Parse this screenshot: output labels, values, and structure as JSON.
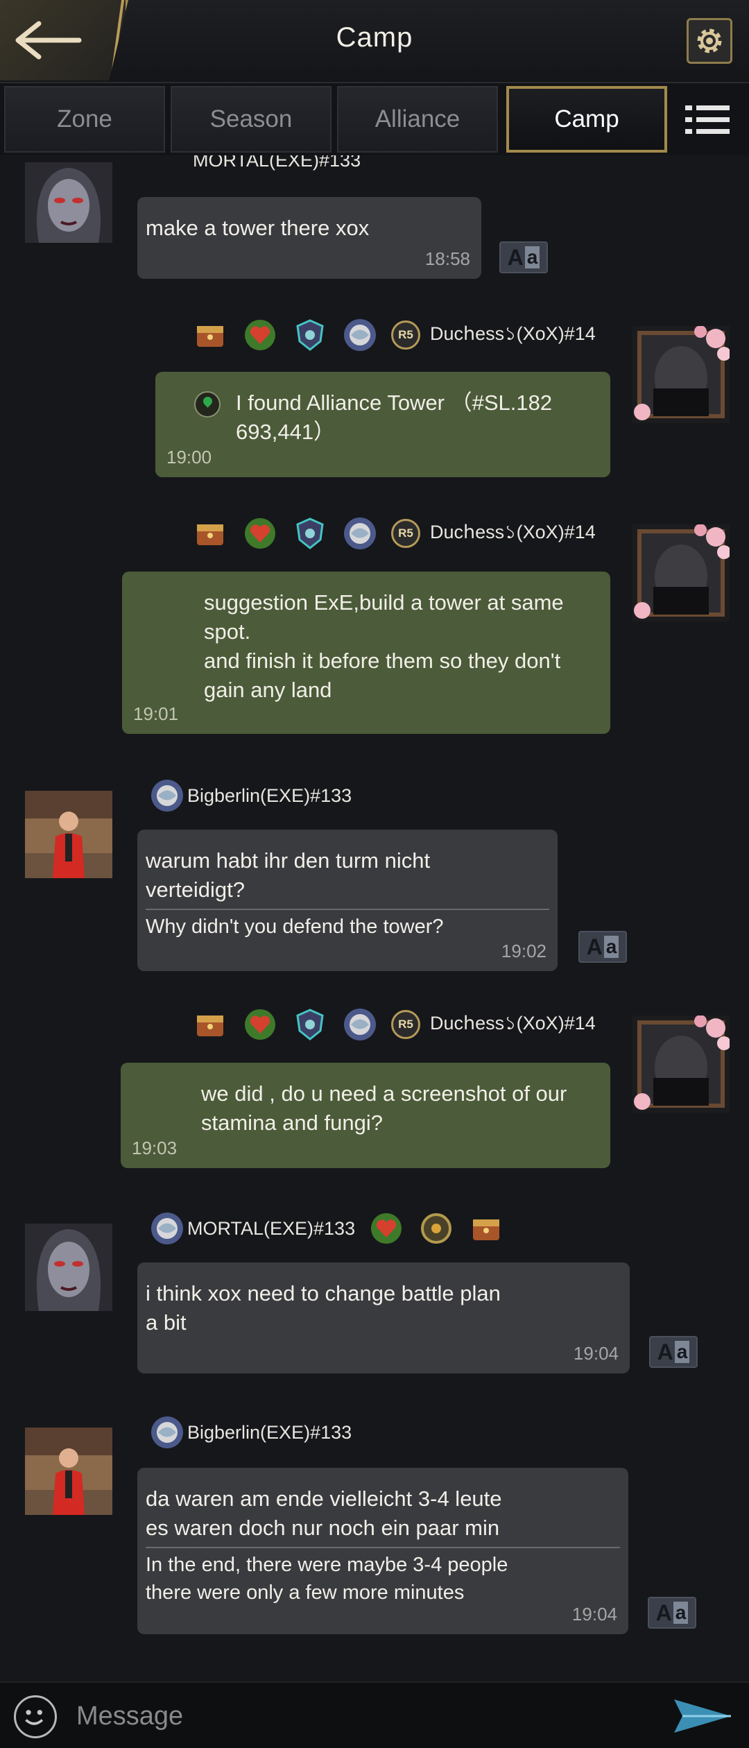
{
  "header": {
    "title": "Camp",
    "back_icon": "back-arrow-icon",
    "settings_icon": "gear-icon"
  },
  "tabs": [
    {
      "label": "Zone",
      "active": false
    },
    {
      "label": "Season",
      "active": false
    },
    {
      "label": "Alliance",
      "active": false
    },
    {
      "label": "Camp",
      "active": true
    }
  ],
  "messages": [
    {
      "sender": "MORTAL(EXE)#133",
      "side": "left",
      "text": "make a tower there xox",
      "time": "18:58"
    },
    {
      "sender": "Ducհess১(XoX)#14",
      "side": "right",
      "rank": "R5",
      "text_line1": "I found Alliance Tower  （#SL.182",
      "text_line2": "693,441）",
      "time": "19:00"
    },
    {
      "sender": "Ducհess১(XoX)#14",
      "side": "right",
      "rank": "R5",
      "text_line1": "suggestion ExE,build a tower at same",
      "text_line2": " spot.",
      "text_line3": "and finish it before them so they don't",
      "text_line4": " gain any land",
      "time": "19:01"
    },
    {
      "sender": "Bigberlin(EXE)#133",
      "side": "left",
      "text_line1": "warum habt ihr den turm nicht",
      "text_line2": "verteidigt?",
      "translation": "Why didn't you defend the tower?",
      "time": "19:02"
    },
    {
      "sender": "Ducհess১(XoX)#14",
      "side": "right",
      "rank": "R5",
      "text_line1": "we did , do u need a screenshot of our",
      "text_line2": " stamina and fungi?",
      "time": "19:03"
    },
    {
      "sender": "MORTAL(EXE)#133",
      "side": "left",
      "text_line1": "i think xox need to change battle plan",
      "text_line2": "a bit",
      "time": "19:04"
    },
    {
      "sender": "Bigberlin(EXE)#133",
      "side": "left",
      "text_line1": "da waren am ende vielleicht 3-4 leute",
      "text_line2": "es waren doch nur noch ein paar min",
      "translation_line1": "In the end, there were maybe 3-4 people",
      "translation_line2": "there were only a few more minutes",
      "time": "19:04"
    }
  ],
  "translate_button": {
    "big": "A",
    "small": "a"
  },
  "composer": {
    "placeholder": "Message",
    "emoji_icon": "smiley-icon",
    "send_icon": "send-arrow-icon"
  }
}
